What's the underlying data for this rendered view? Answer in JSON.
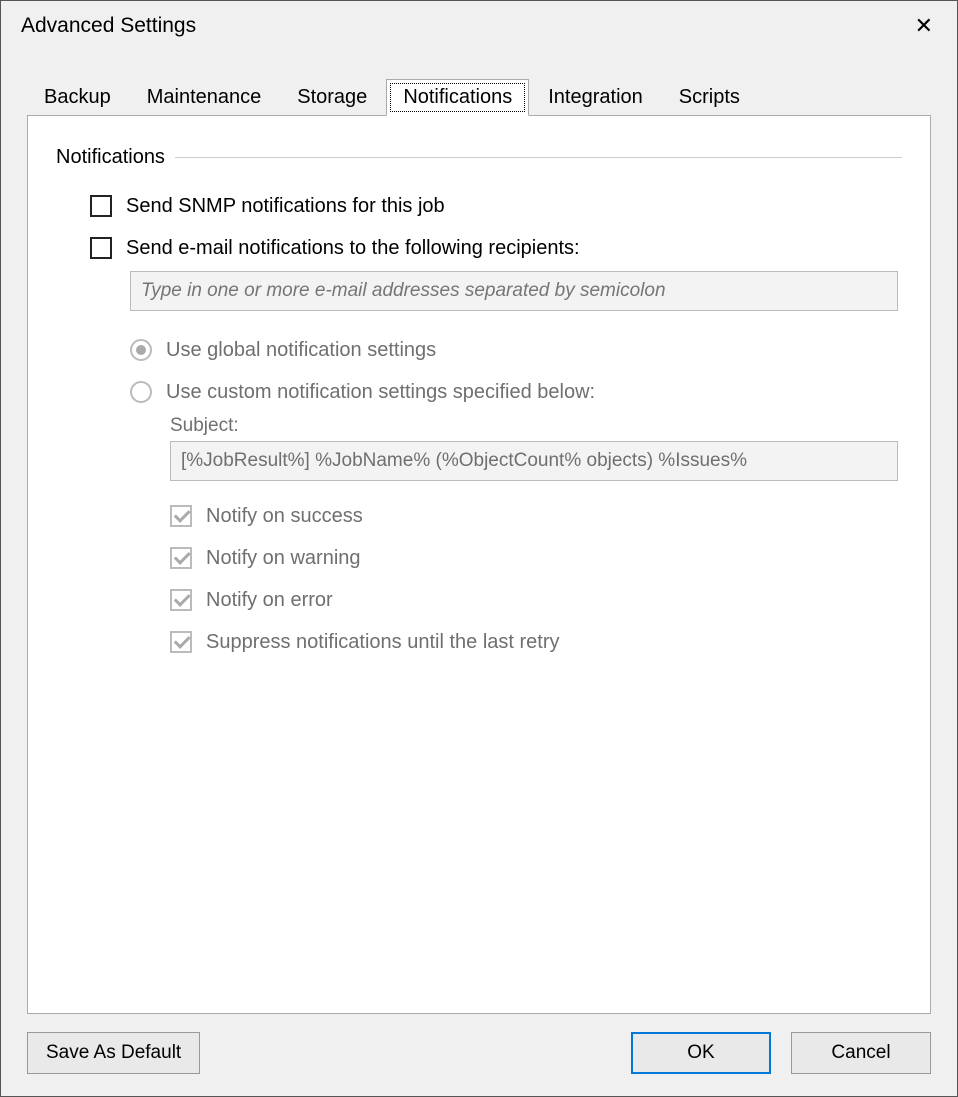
{
  "window": {
    "title": "Advanced Settings"
  },
  "tabs": [
    "Backup",
    "Maintenance",
    "Storage",
    "Notifications",
    "Integration",
    "Scripts"
  ],
  "active_tab_index": 3,
  "group": {
    "title": "Notifications"
  },
  "options": {
    "snmp_label": "Send SNMP notifications for this job",
    "snmp_checked": false,
    "email_label": "Send e-mail notifications to the following recipients:",
    "email_checked": false,
    "email_input_value": "",
    "email_input_placeholder": "Type in one or more e-mail addresses separated by semicolon",
    "radio_global_label": "Use global notification settings",
    "radio_global_selected": true,
    "radio_custom_label": "Use custom notification settings specified below:",
    "radio_custom_selected": false,
    "subject_label": "Subject:",
    "subject_value": "[%JobResult%] %JobName% (%ObjectCount% objects) %Issues%",
    "notify_success_label": "Notify on success",
    "notify_success_checked": true,
    "notify_warning_label": "Notify on warning",
    "notify_warning_checked": true,
    "notify_error_label": "Notify on error",
    "notify_error_checked": true,
    "suppress_label": "Suppress notifications until the last retry",
    "suppress_checked": true
  },
  "footer": {
    "save_default": "Save As Default",
    "ok": "OK",
    "cancel": "Cancel"
  }
}
